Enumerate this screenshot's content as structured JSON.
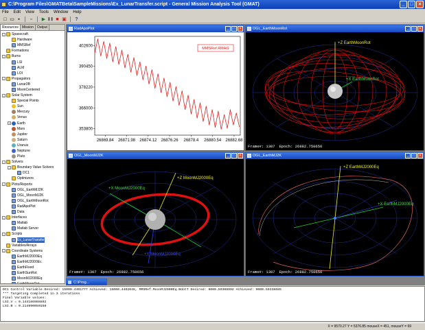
{
  "window": {
    "title": "C:\\Program Files\\GMATBeta\\SampleMissions\\Ex_LunarTransfer.script - General Mission Analysis Tool (GMAT)",
    "controls": [
      "_",
      "□",
      "×"
    ]
  },
  "menu": [
    "File",
    "Edit",
    "View",
    "Tools",
    "Window",
    "Help"
  ],
  "toolbar": {
    "icons": [
      "new-icon",
      "open-icon",
      "save-icon",
      "copy-icon",
      "run-icon",
      "pause-icon",
      "stop-icon",
      "clear-icon",
      "help-icon"
    ],
    "glyphs": [
      "□",
      "▭",
      "▪",
      "▫",
      "▶",
      "❚❚",
      "■",
      "▣",
      "?"
    ]
  },
  "resources_panel": {
    "tabs": [
      "Resources",
      "Mission",
      "Output"
    ],
    "tree": [
      {
        "label": "Spacecraft",
        "level": 0,
        "type": "folder",
        "expand": "-"
      },
      {
        "label": "Hardware",
        "level": 1,
        "type": "folder"
      },
      {
        "label": "MMSRef",
        "level": 1,
        "type": "item"
      },
      {
        "label": "Formations",
        "level": 0,
        "type": "folder"
      },
      {
        "label": "Burns",
        "level": 0,
        "type": "folder",
        "expand": "-"
      },
      {
        "label": "LSI",
        "level": 1,
        "type": "item"
      },
      {
        "label": "ALM",
        "level": 1,
        "type": "item"
      },
      {
        "label": "LOI",
        "level": 1,
        "type": "item"
      },
      {
        "label": "Propagators",
        "level": 0,
        "type": "folder",
        "expand": "-"
      },
      {
        "label": "Lunar3B",
        "level": 1,
        "type": "item"
      },
      {
        "label": "MoonCentered",
        "level": 1,
        "type": "item"
      },
      {
        "label": "Solar System",
        "level": 0,
        "type": "folder",
        "expand": "-"
      },
      {
        "label": "Special Points",
        "level": 1,
        "type": "folder"
      },
      {
        "label": "Sun",
        "level": 1,
        "type": "planet",
        "color": "#f0c020"
      },
      {
        "label": "Mercury",
        "level": 1,
        "type": "planet",
        "color": "#a08060"
      },
      {
        "label": "Venus",
        "level": 1,
        "type": "planet",
        "color": "#d0b060"
      },
      {
        "label": "Earth",
        "level": 1,
        "type": "planet",
        "color": "#3060c0",
        "expand": "+"
      },
      {
        "label": "Mars",
        "level": 1,
        "type": "planet",
        "color": "#c05030"
      },
      {
        "label": "Jupiter",
        "level": 1,
        "type": "planet",
        "color": "#c09060"
      },
      {
        "label": "Saturn",
        "level": 1,
        "type": "planet",
        "color": "#d0b080"
      },
      {
        "label": "Uranus",
        "level": 1,
        "type": "planet",
        "color": "#60b0c0"
      },
      {
        "label": "Neptune",
        "level": 1,
        "type": "planet",
        "color": "#4060d0"
      },
      {
        "label": "Pluto",
        "level": 1,
        "type": "planet",
        "color": "#a09080"
      },
      {
        "label": "Solvers",
        "level": 0,
        "type": "folder",
        "expand": "-"
      },
      {
        "label": "Boundary Value Solvers",
        "level": 1,
        "type": "folder",
        "expand": "-"
      },
      {
        "label": "DC1",
        "level": 2,
        "type": "item"
      },
      {
        "label": "Optimizers",
        "level": 1,
        "type": "folder"
      },
      {
        "label": "Plots/Reports",
        "level": 0,
        "type": "folder",
        "expand": "-"
      },
      {
        "label": "OGL_EarthMJ2K",
        "level": 1,
        "type": "item"
      },
      {
        "label": "OGL_MoonMJ2K",
        "level": 1,
        "type": "item"
      },
      {
        "label": "OGL_EarthMoonRot",
        "level": 1,
        "type": "item"
      },
      {
        "label": "RadApoPlot",
        "level": 1,
        "type": "item"
      },
      {
        "label": "Data",
        "level": 1,
        "type": "item"
      },
      {
        "label": "Interfaces",
        "level": 0,
        "type": "folder",
        "expand": "-"
      },
      {
        "label": "Matlab",
        "level": 1,
        "type": "item"
      },
      {
        "label": "Matlab Server",
        "level": 1,
        "type": "item"
      },
      {
        "label": "Scripts",
        "level": 0,
        "type": "folder",
        "expand": "-"
      },
      {
        "label": "Ex_LunarTransfer",
        "level": 1,
        "type": "item",
        "selected": true
      },
      {
        "label": "Variables/Arrays",
        "level": 0,
        "type": "folder"
      },
      {
        "label": "Coordinate Systems",
        "level": 0,
        "type": "folder",
        "expand": "-"
      },
      {
        "label": "EarthMJ2000Eq",
        "level": 1,
        "type": "item"
      },
      {
        "label": "EarthMJ2000Ec",
        "level": 1,
        "type": "item"
      },
      {
        "label": "EarthFixed",
        "level": 1,
        "type": "item"
      },
      {
        "label": "EarthSunRot",
        "level": 1,
        "type": "item"
      },
      {
        "label": "MoonMJ2000Eq",
        "level": 1,
        "type": "item"
      },
      {
        "label": "EarthMoonRot",
        "level": 1,
        "type": "item"
      },
      {
        "label": "Functions",
        "level": 0,
        "type": "folder",
        "expand": "+"
      }
    ]
  },
  "windows": {
    "radapo": {
      "title": "RadApoPlot",
      "legend": "MMSRef.RMAG",
      "colors": {
        "bg": "#ffffff",
        "line": "#e02020",
        "plot_border": "#000000"
      }
    },
    "earthmoonrot": {
      "title": "OGL_EarthMoonRot",
      "axis_z": "+Z EarthMoonRot",
      "axis_x": "+X EarthMoonRot",
      "frame_label": "Frame#: 1307",
      "epoch_label": "Epoch: 26882.750656"
    },
    "moonmj2k": {
      "title": "OGL_MoonMJ2K",
      "axis_z": "+Z MoonMJ2000Eq",
      "axis_x": "+X MoonMJ2000Eq",
      "axis_y": "+Y MoonMJ2000Eq",
      "frame_label": "Frame#: 1307",
      "epoch_label": "Epoch: 26882.750656"
    },
    "earthmj2k": {
      "title": "OGL_EarthMJ2K",
      "axis_z": "+Z EarthMJ2000Eq",
      "axis_x": "+X EarthMJ2000Eq",
      "frame_label": "Frame#: 1307",
      "epoch_label": "Epoch: 26882.750656"
    }
  },
  "chart_data": {
    "type": "line",
    "title": "",
    "xlabel": "",
    "ylabel": "",
    "x_ticks": [
      "26869.84",
      "26871.98",
      "26874.12",
      "26876.26",
      "26878.4",
      "26880.54",
      "26882.68"
    ],
    "y_ticks": [
      "402600",
      "390450",
      "378220",
      "366000",
      "353800"
    ],
    "xlim": [
      26868.8,
      26883.3
    ],
    "ylim": [
      350000,
      408000
    ],
    "series": [
      {
        "name": "MMSRef.RMAG",
        "color": "#e02020",
        "x": [
          26868.8,
          26869.1,
          26869.4,
          26869.7,
          26870.0,
          26870.3,
          26870.6,
          26870.9,
          26871.2,
          26871.5,
          26871.8,
          26872.1,
          26872.4,
          26872.7,
          26873.0,
          26873.3,
          26873.6,
          26873.9,
          26874.2,
          26874.5,
          26874.8,
          26875.1,
          26875.4,
          26875.7,
          26876.0,
          26876.3,
          26876.6,
          26876.9,
          26877.2,
          26877.5,
          26877.8,
          26878.1,
          26878.4,
          26878.7,
          26879.0,
          26879.3,
          26879.6,
          26879.9,
          26880.2,
          26880.5,
          26880.8,
          26881.1,
          26881.4,
          26881.7,
          26882.0,
          26882.3,
          26882.6,
          26882.9,
          26883.2
        ],
        "y": [
          398000,
          406500,
          396500,
          405000,
          395000,
          404000,
          393000,
          402000,
          391500,
          400000,
          389500,
          397500,
          387000,
          395500,
          385000,
          393000,
          382500,
          390500,
          380000,
          388500,
          377500,
          386000,
          375000,
          383500,
          372500,
          381000,
          370000,
          378500,
          367500,
          376000,
          365000,
          373500,
          362500,
          371000,
          360000,
          369000,
          358000,
          367000,
          356000,
          365000,
          354500,
          364000,
          353500,
          362000,
          354000,
          365000,
          356000,
          363000,
          355000
        ]
      }
    ]
  },
  "minimized": {
    "title": "C:\\Prog..."
  },
  "output": {
    "lines": [
      "DC1 Control Variable      Desired: 15000.4401777  Achieved: 15000.4402046,  MMSRef.MoonMJ2000Eq.BdotT  Desired: 9000.59308992  Achieved: 9000.59338685",
      "*** Targeting Completed in 3 iterations",
      "Final Variable values:",
      "LSI.V = 0.144186988892",
      "LSI.B = 0.214990050150"
    ]
  },
  "status": {
    "text": "X = 9570.27  Y = 5376.85  mouseX = 451, mouseY = 69"
  }
}
